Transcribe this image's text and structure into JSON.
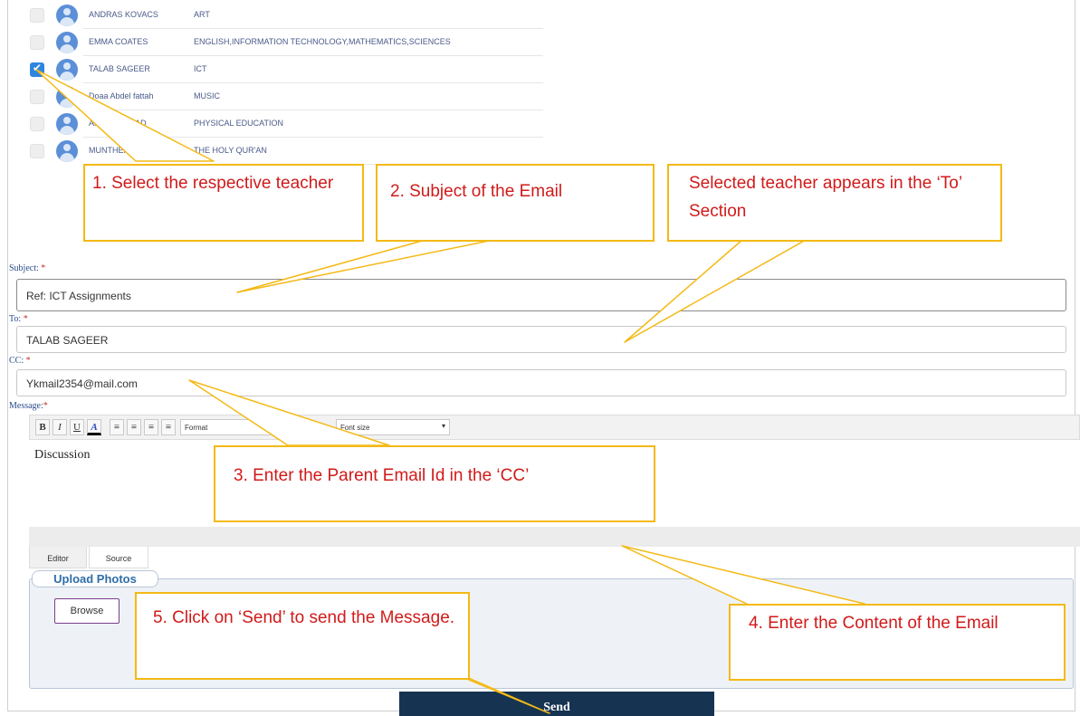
{
  "teachers": [
    {
      "name": "ANDRAS KOVACS",
      "subjects": "ART",
      "checked": false
    },
    {
      "name": "EMMA COATES",
      "subjects": "ENGLISH,INFORMATION TECHNOLOGY,MATHEMATICS,SCIENCES",
      "checked": false
    },
    {
      "name": "TALAB SAGEER",
      "subjects": "ICT",
      "checked": true
    },
    {
      "name": "Doaa Abdel fattah",
      "subjects": "MUSIC",
      "checked": false
    },
    {
      "name": "ANAYA HAMAD",
      "subjects": "PHYSICAL EDUCATION",
      "checked": false
    },
    {
      "name": "MUNTHER ALATTAR",
      "subjects": "THE HOLY QUR'AN",
      "checked": false
    }
  ],
  "form": {
    "subject_label": "Subject:",
    "subject_value": "Ref: ICT Assignments",
    "to_label": "To:",
    "to_value": "TALAB SAGEER",
    "cc_label": "CC:",
    "cc_value": "Ykmail2354@mail.com",
    "message_label": "Message:",
    "required_mark": "*"
  },
  "editor": {
    "bold": "B",
    "italic": "I",
    "underline": "U",
    "font_color": "A",
    "format_select": "Format",
    "font_size_select": "Font size",
    "content": "Discussion",
    "tabs": [
      "Editor",
      "Source"
    ]
  },
  "upload": {
    "legend": "Upload Photos",
    "browse": "Browse"
  },
  "send_label": "Send",
  "callouts": {
    "c1": "1. Select the respective teacher",
    "c2": "2. Subject of the Email",
    "c3": "Selected teacher appears in the ‘To’ Section",
    "c4": "3. Enter the Parent Email Id in the ‘CC’",
    "c5": "4. Enter the Content of the Email",
    "c6": "5. Click on ‘Send’ to send the Message."
  },
  "colors": {
    "callout_border": "#f4b915",
    "callout_text": "#d11a1a",
    "send_bg": "#163352",
    "checkbox_checked": "#2f86de"
  }
}
